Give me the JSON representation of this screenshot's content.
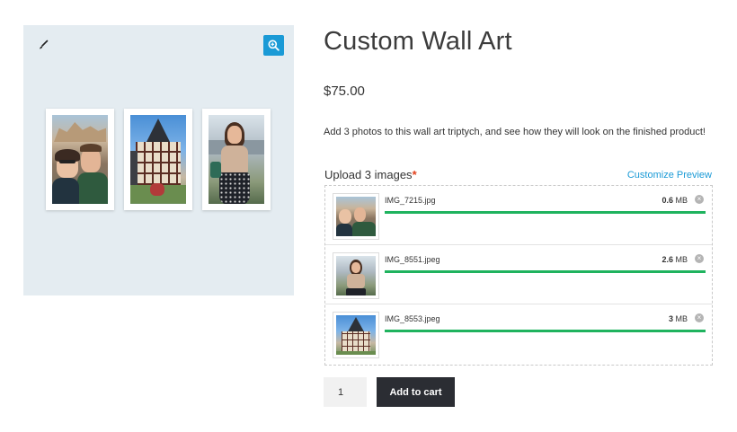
{
  "preview": {
    "edit_icon": "paintbrush-icon",
    "zoom_icon": "zoom-in-icon",
    "photos": [
      "couple-selfie",
      "half-timbered-house",
      "woman-portrait"
    ]
  },
  "product": {
    "title": "Custom Wall Art",
    "price": "$75.00",
    "description": "Add 3 photos to this wall art triptych, and see how they will look on the finished product!"
  },
  "upload": {
    "label": "Upload 3 images",
    "required_mark": "*",
    "customize_link": "Customize Preview",
    "files": [
      {
        "name": "IMG_7215.jpg",
        "size_value": "0.6",
        "size_unit": "MB",
        "progress": 1.0,
        "remove": "×"
      },
      {
        "name": "IMG_8551.jpeg",
        "size_value": "2.6",
        "size_unit": "MB",
        "progress": 1.0,
        "remove": "×"
      },
      {
        "name": "IMG_8553.jpeg",
        "size_value": "3",
        "size_unit": "MB",
        "progress": 1.0,
        "remove": "×"
      }
    ]
  },
  "cart": {
    "quantity": "1",
    "add_label": "Add to cart"
  },
  "colors": {
    "accent": "#1a9ad6",
    "progress": "#1fb35e",
    "required": "#e2401c",
    "button": "#2b2d33",
    "preview_bg": "#e4ecf1"
  }
}
